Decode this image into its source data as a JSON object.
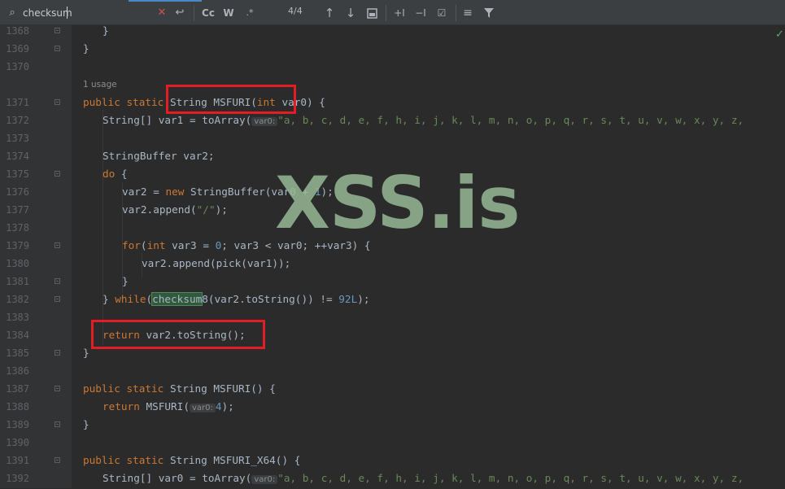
{
  "search": {
    "query": "checksum",
    "match_count": "4/4",
    "case_label": "Cc",
    "words_label": "W",
    "regex_label": ".*"
  },
  "gutter": {
    "line_numbers": [
      "1368",
      "1369",
      "1370",
      "",
      "1371",
      "1372",
      "1373",
      "1374",
      "1375",
      "1376",
      "1377",
      "1378",
      "1379",
      "1380",
      "1381",
      "1382",
      "1383",
      "1384",
      "1385",
      "1386",
      "1387",
      "1388",
      "1389",
      "1390",
      "1391",
      "1392"
    ]
  },
  "code": {
    "usage_hint": "1 usage",
    "param_hint": "var0:",
    "lines": {
      "l1368": "}",
      "l1369": "}",
      "l1371_pre": "public static ",
      "l1371_type": "String",
      "l1371_name": " MSFURI(",
      "l1371_int": "int",
      "l1371_post": " var0) {",
      "l1372_a": "String[] var1 = toArray(",
      "l1372_b": "\"a, b, c, d, e, f, h, i, j, k, l, m, n, o, p, q, r, s, t, u, v, w, x, y, z,",
      "l1374": "StringBuffer var2;",
      "l1375_kw": "do",
      "l1375_rest": " {",
      "l1376_a": "var2 = ",
      "l1376_kw": "new",
      "l1376_b": " StringBuffer(var0 + ",
      "l1376_num": "1",
      "l1376_c": ");",
      "l1377_a": "var2.append(",
      "l1377_str": "\"/\"",
      "l1377_b": ");",
      "l1379_kw1": "for",
      "l1379_a": "(",
      "l1379_kw2": "int",
      "l1379_b": " var3 = ",
      "l1379_num": "0",
      "l1379_c": "; var3 < var0; ++var3) {",
      "l1380": "var2.append(pick(var1));",
      "l1381": "}",
      "l1382_a": "} ",
      "l1382_kw": "while",
      "l1382_b": "(",
      "l1382_found": "checksum",
      "l1382_c": "8(var2.toString()) != ",
      "l1382_num": "92L",
      "l1382_d": ");",
      "l1384_kw": "return",
      "l1384_rest": " var2.toString();",
      "l1385": "}",
      "l1387_kw": "public static",
      "l1387_rest": " String MSFURI() {",
      "l1388_kw": "return",
      "l1388_a": " MSFURI(",
      "l1388_num": "4",
      "l1388_b": ");",
      "l1389": "}",
      "l1391_kw": "public static",
      "l1391_rest": " String MSFURI_X64() {",
      "l1392_a": "String[] var0 = toArray(",
      "l1392_b": "\"a, b, c, d, e, f, h, i, j, k, l, m, n, o, p, q, r, s, t, u, v, w, x, y, z,"
    }
  },
  "watermark": "XSS.is",
  "colors": {
    "keyword": "#cc7832",
    "number": "#6897bb",
    "string": "#6a8759",
    "text": "#a9b7c6",
    "annotation_box": "#e41c24",
    "search_match": "#32593d"
  }
}
